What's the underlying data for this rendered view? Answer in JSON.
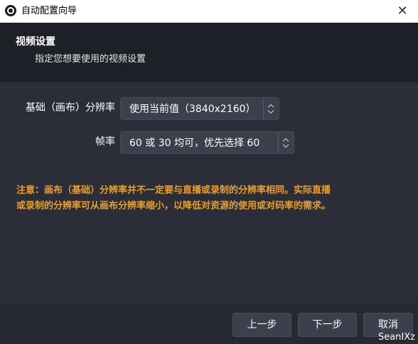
{
  "window": {
    "title": "自动配置向导",
    "close_symbol": "✕",
    "icon": "obs-logo-icon"
  },
  "header": {
    "title": "视频设置",
    "subtitle": "指定您想要使用的视频设置"
  },
  "form": {
    "resolution": {
      "label": "基础（画布）分辨率",
      "value": "使用当前值（3840x2160）"
    },
    "fps": {
      "label": "帧率",
      "value": "60 或 30 均可，优先选择 60"
    }
  },
  "warning": {
    "line1": "注意：画布（基础）分辨率并不一定要与直播或录制的分辨率相同。实际直播",
    "line2": "或录制的分辨率可从画布分辨率缩小，以降低对资源的使用或对码率的需求。",
    "color": "#e89e2a"
  },
  "buttons": {
    "back": "上一步",
    "next": "下一步",
    "cancel": "取消"
  },
  "watermark": "SeanIXz"
}
